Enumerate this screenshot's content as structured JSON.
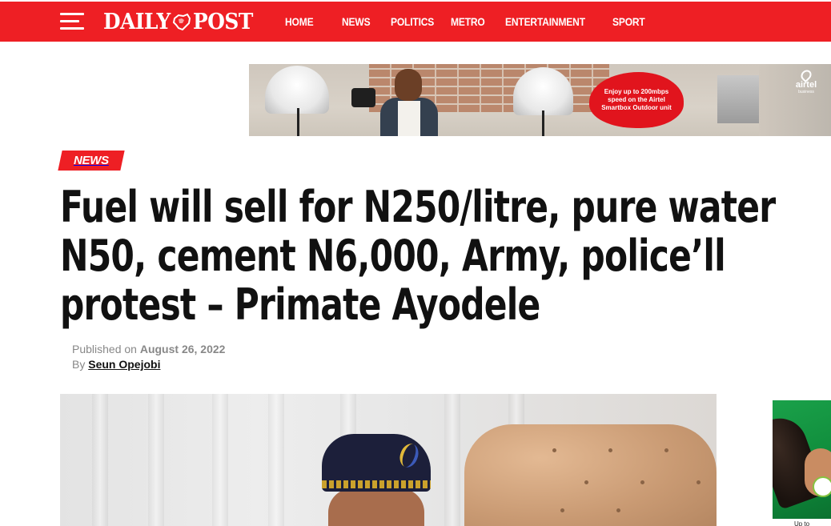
{
  "brand": {
    "logo_word_1": "DAILY",
    "logo_word_2": "POST",
    "accent": "#ee1f24"
  },
  "nav": {
    "menu_icon": "hamburger-menu-icon",
    "items": [
      {
        "label": "HOME"
      },
      {
        "label": "NEWS"
      },
      {
        "label": "POLITICS"
      },
      {
        "label": "METRO"
      },
      {
        "label": "ENTERTAINMENT"
      },
      {
        "label": "SPORT"
      }
    ]
  },
  "top_ad": {
    "headline": "Enjoy up to 200mbps speed on the Airtel Smartbox Outdoor unit",
    "brand": "airtel",
    "brand_sub": "business",
    "bubble_color": "#e1141d"
  },
  "article": {
    "category": "NEWS",
    "title": "Fuel will sell for N250/litre, pure water N50, cement N6,000, Army, police’ll protest – Primate Ayodele",
    "published_label": "Published on",
    "published_date": "August 26, 2022",
    "by_label": "By",
    "author": "Seun Opejobi"
  },
  "side_ad": {
    "caption": "Up to"
  }
}
